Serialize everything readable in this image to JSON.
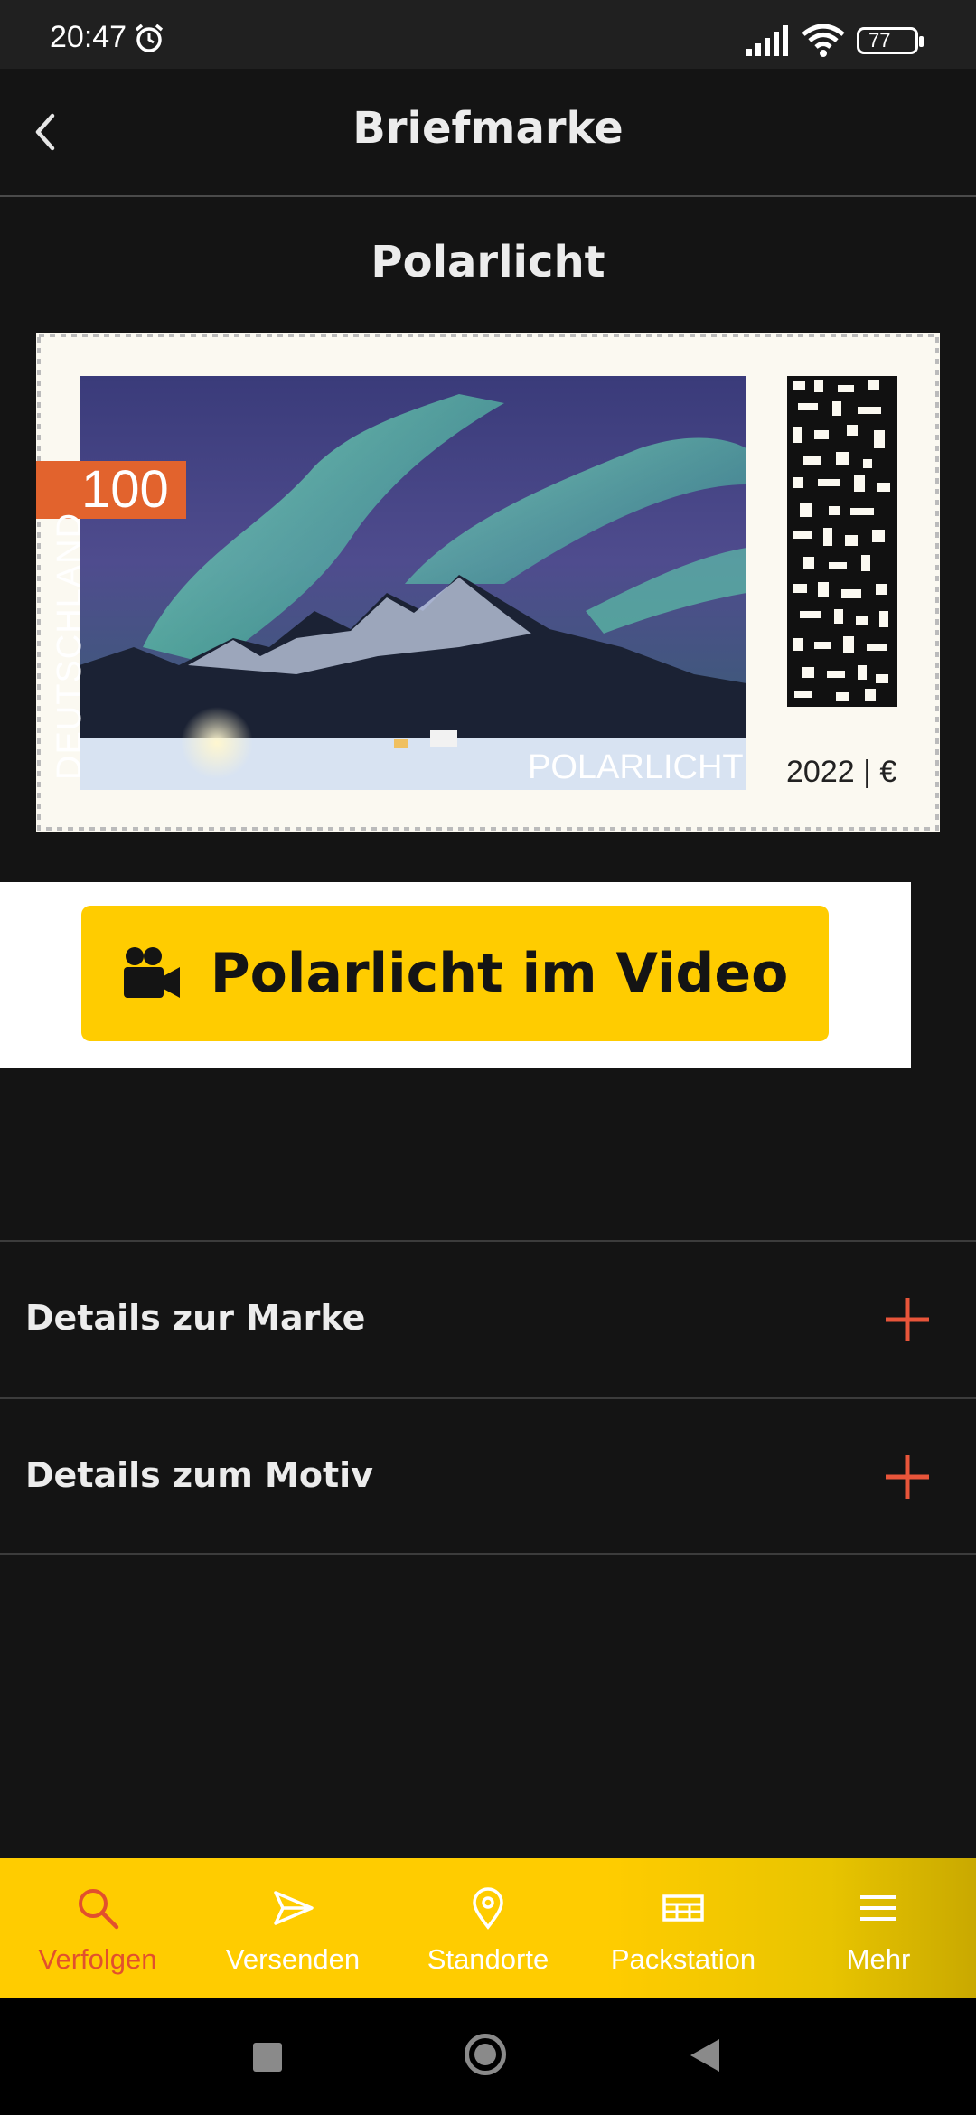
{
  "status_bar": {
    "time": "20:47",
    "battery": "77"
  },
  "header": {
    "title": "Briefmarke"
  },
  "stamp": {
    "title": "Polarlicht",
    "value": "100",
    "country": "DEUTSCHLAND",
    "motif": "POLARLICHT",
    "year": "2022 | €"
  },
  "video_button": {
    "label": "Polarlicht im Video"
  },
  "accordion": [
    {
      "label": "Details zur Marke"
    },
    {
      "label": "Details zum Motiv"
    }
  ],
  "bottom_nav": [
    {
      "label": "Verfolgen",
      "icon": "search-icon",
      "active": true
    },
    {
      "label": "Versenden",
      "icon": "send-icon"
    },
    {
      "label": "Standorte",
      "icon": "location-pin-icon"
    },
    {
      "label": "Packstation",
      "icon": "packstation-icon"
    },
    {
      "label": "Mehr",
      "icon": "menu-icon"
    }
  ],
  "colors": {
    "accent": "#ffcc00",
    "active": "#e2502d",
    "plus": "#e8553a",
    "background": "#141414"
  }
}
